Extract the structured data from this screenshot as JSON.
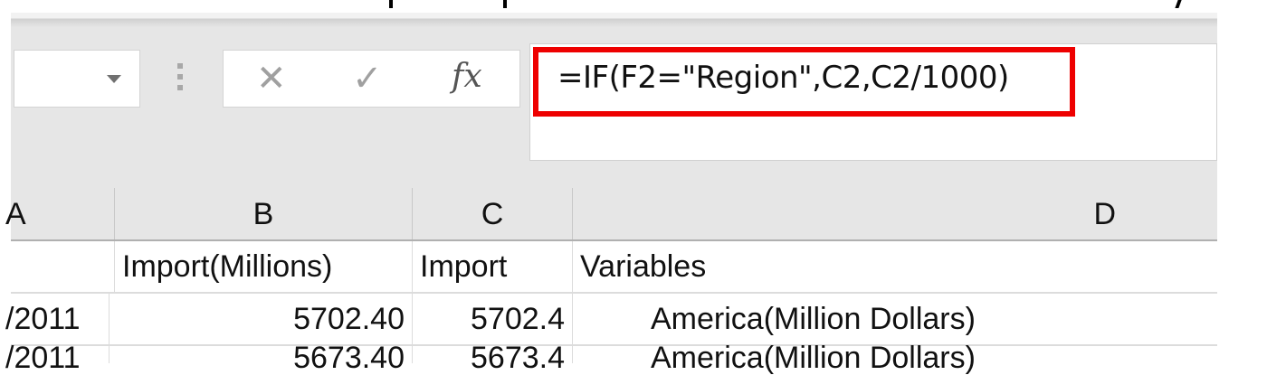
{
  "formula_bar": {
    "name_box": "",
    "cancel_icon": "✕",
    "enter_icon": "✓",
    "fx_label": "fx",
    "formula": "=IF(F2=\"Region\",C2,C2/1000)"
  },
  "columns": [
    "A",
    "B",
    "C",
    "D"
  ],
  "rows": [
    {
      "a": "",
      "b": "Import(Millions)",
      "c": "Import",
      "d": "Variables"
    },
    {
      "a": "/2011",
      "b": "5702.40",
      "c": "5702.4",
      "d": "America(Million Dollars)"
    },
    {
      "a": "/2011",
      "b": "5673.40",
      "c": "5673.4",
      "d": "America(Million Dollars)"
    }
  ],
  "colors": {
    "highlight": "#ee0000",
    "toolbar": "#e6e6e6"
  }
}
